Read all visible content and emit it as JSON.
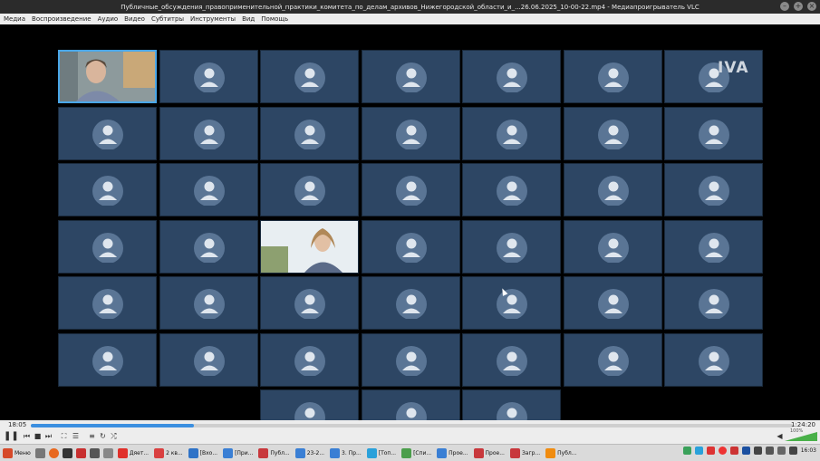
{
  "window": {
    "title": "Публичные_обсуждения_правоприменительной_практики_комитета_по_делам_архивов_Нижегородской_области_и_...26.06.2025_10-00-22.mp4 - Медиапроигрыватель VLC"
  },
  "menu": {
    "items": [
      "Медиа",
      "Воспроизведение",
      "Аудио",
      "Видео",
      "Субтитры",
      "Инструменты",
      "Вид",
      "Помощь"
    ]
  },
  "video": {
    "logo": "IVA"
  },
  "player": {
    "current_time": "18:05",
    "total_time": "1:24:20",
    "progress": 0.214,
    "volume_label": "100%"
  },
  "taskbar": {
    "start_label": "Меню",
    "items": [
      {
        "label": "Дяет...",
        "color": "#e0302a"
      },
      {
        "label": "2 кв...",
        "color": "#d94040"
      },
      {
        "label": "[Вхо...",
        "color": "#2f73c7"
      },
      {
        "label": "[При...",
        "color": "#3a7fd4"
      },
      {
        "label": "Публ...",
        "color": "#c8383c"
      },
      {
        "label": "23-2...",
        "color": "#3a7fd4"
      },
      {
        "label": "3. Пр...",
        "color": "#3a7fd4"
      },
      {
        "label": "[Топ...",
        "color": "#2aa1da"
      },
      {
        "label": "[Спи...",
        "color": "#4b9e4b"
      },
      {
        "label": "Прое...",
        "color": "#3a7fd4"
      },
      {
        "label": "Прое...",
        "color": "#c8383c"
      },
      {
        "label": "Загр...",
        "color": "#c8383c"
      },
      {
        "label": "Публ...",
        "color": "#f08c10"
      }
    ],
    "clock": "16:03"
  }
}
